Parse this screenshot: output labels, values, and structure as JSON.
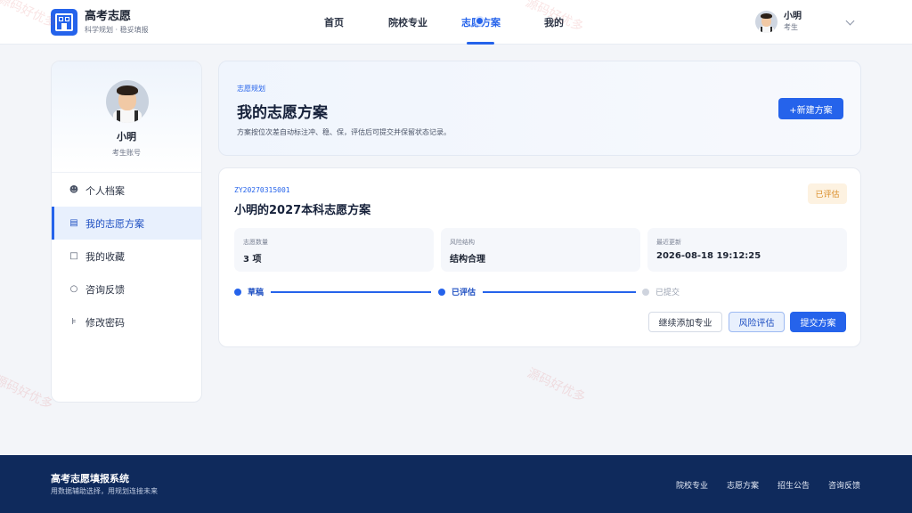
{
  "header": {
    "brand_title": "高考志愿",
    "brand_subtitle": "科学规划 · 稳妥填报",
    "nav": [
      {
        "label": "首页",
        "active": false
      },
      {
        "label": "院校专业",
        "active": false
      },
      {
        "label": "志愿方案",
        "active": true
      },
      {
        "label": "我的",
        "active": false
      }
    ],
    "user_name": "小明",
    "user_role": "考生"
  },
  "sidebar": {
    "name": "小明",
    "account_type": "考生账号",
    "items": [
      {
        "label": "个人档案",
        "icon": "user-icon",
        "active": false
      },
      {
        "label": "我的志愿方案",
        "icon": "document-icon",
        "active": true
      },
      {
        "label": "我的收藏",
        "icon": "bookmark-icon",
        "active": false
      },
      {
        "label": "咨询反馈",
        "icon": "chat-icon",
        "active": false
      },
      {
        "label": "修改密码",
        "icon": "key-icon",
        "active": false
      }
    ]
  },
  "intro": {
    "eyebrow": "志愿规划",
    "title": "我的志愿方案",
    "description": "方案按位次差自动标注冲、稳、保，评估后可提交并保留状态记录。",
    "new_button": "+新建方案"
  },
  "plan": {
    "id": "ZY20270315001",
    "title": "小明的2027本科志愿方案",
    "status": "已评估",
    "stats": [
      {
        "label": "志愿数量",
        "value": "3 项"
      },
      {
        "label": "风险结构",
        "value": "结构合理"
      },
      {
        "label": "最近更新",
        "value": "2026-08-18 19:12:25"
      }
    ],
    "steps": [
      {
        "label": "草稿",
        "done": true
      },
      {
        "label": "已评估",
        "done": true
      },
      {
        "label": "已提交",
        "done": false
      }
    ],
    "buttons": {
      "add_major": "继续添加专业",
      "risk_eval": "风险评估",
      "submit": "提交方案"
    }
  },
  "footer": {
    "title": "高考志愿填报系统",
    "subtitle": "用数据辅助选择，用规划连接未来",
    "links": [
      "院校专业",
      "志愿方案",
      "招生公告",
      "咨询反馈"
    ]
  },
  "watermark": "源码好优多",
  "colors": {
    "accent": "#2563eb",
    "footer_bg": "#0f2a5c",
    "badge_text": "#d98b24"
  }
}
